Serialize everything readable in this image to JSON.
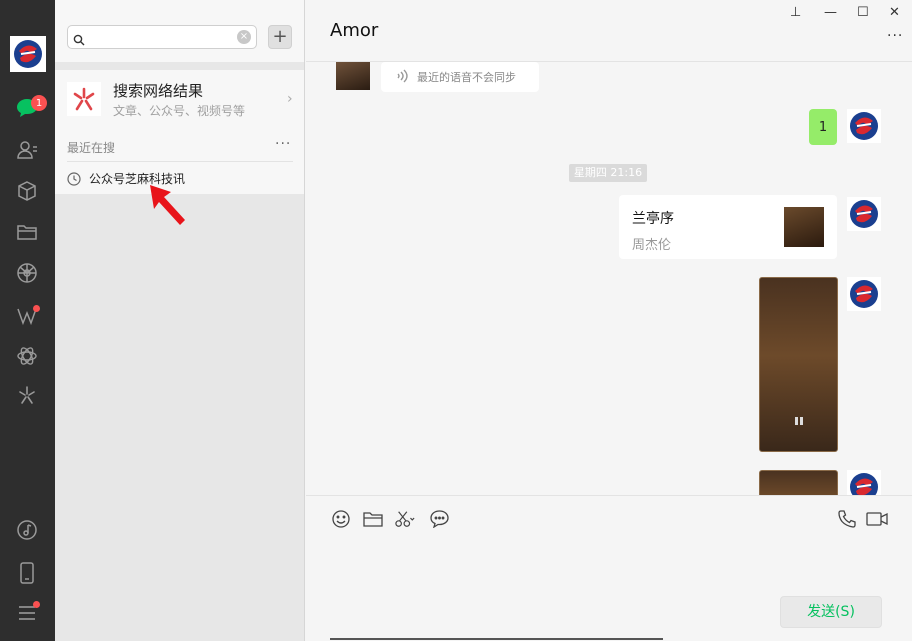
{
  "nav": {
    "unread_count": "1",
    "items": [
      "chat-icon",
      "contacts-icon",
      "box-icon",
      "folder-icon",
      "moments-icon",
      "wave-icon",
      "atom-icon",
      "sparkle-icon",
      "music-icon",
      "phone-icon",
      "menu-icon"
    ]
  },
  "search": {
    "value": "",
    "placeholder": "",
    "clear": "×",
    "add": "+"
  },
  "net_result": {
    "title": "搜索网络结果",
    "subtitle": "文章、公众号、视频号等",
    "chevron": "›"
  },
  "recent": {
    "label": "最近在搜",
    "more": "···",
    "item": "公众号芝麻科技讯"
  },
  "chat": {
    "title": "Amor",
    "more": "···",
    "window_controls": {
      "pin": "⊥",
      "minimize": "—",
      "maximize": "☐",
      "close": "✕"
    },
    "voice_note": "最近的语音不会同步",
    "green_message": "1",
    "timestamp": "星期四 21:16",
    "music_card": {
      "title": "兰亭序",
      "artist": "周杰伦"
    }
  },
  "input": {
    "send_label": "发送(S)"
  },
  "colors": {
    "nav_bg": "#2e2e2e",
    "accent_green": "#07c160",
    "bubble_green": "#95ec69",
    "badge_red": "#fa5151"
  }
}
